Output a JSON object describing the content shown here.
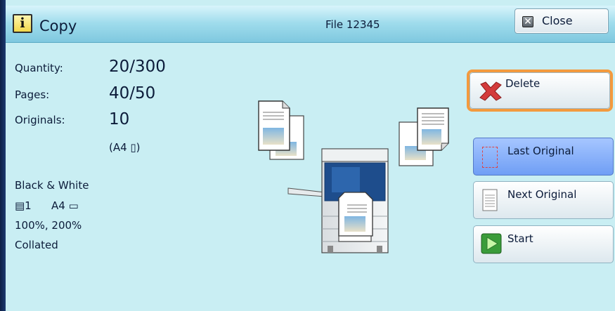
{
  "header": {
    "app_title": "Copy",
    "file_name": "File 12345",
    "close_label": "Close",
    "info_icon": "i"
  },
  "stats": {
    "quantity_label": "Quantity:",
    "quantity_value": "20/300",
    "pages_label": "Pages:",
    "pages_value": "40/50",
    "originals_label": "Originals:",
    "originals_value": "10",
    "paper_size": "(A4 ▯)"
  },
  "settings": {
    "color_mode": "Black & White",
    "tray": "▤1",
    "paper": "A4 ▭",
    "reduce_enlarge": "100%, 200%",
    "output": "Collated"
  },
  "actions": {
    "delete_label": "Delete",
    "last_original_label": "Last Original",
    "next_original_label": "Next Original",
    "start_label": "Start"
  },
  "colors": {
    "screen_bg": "#c9eef3",
    "highlight": "#f39a3e",
    "active_button": "#7aa6f5"
  }
}
